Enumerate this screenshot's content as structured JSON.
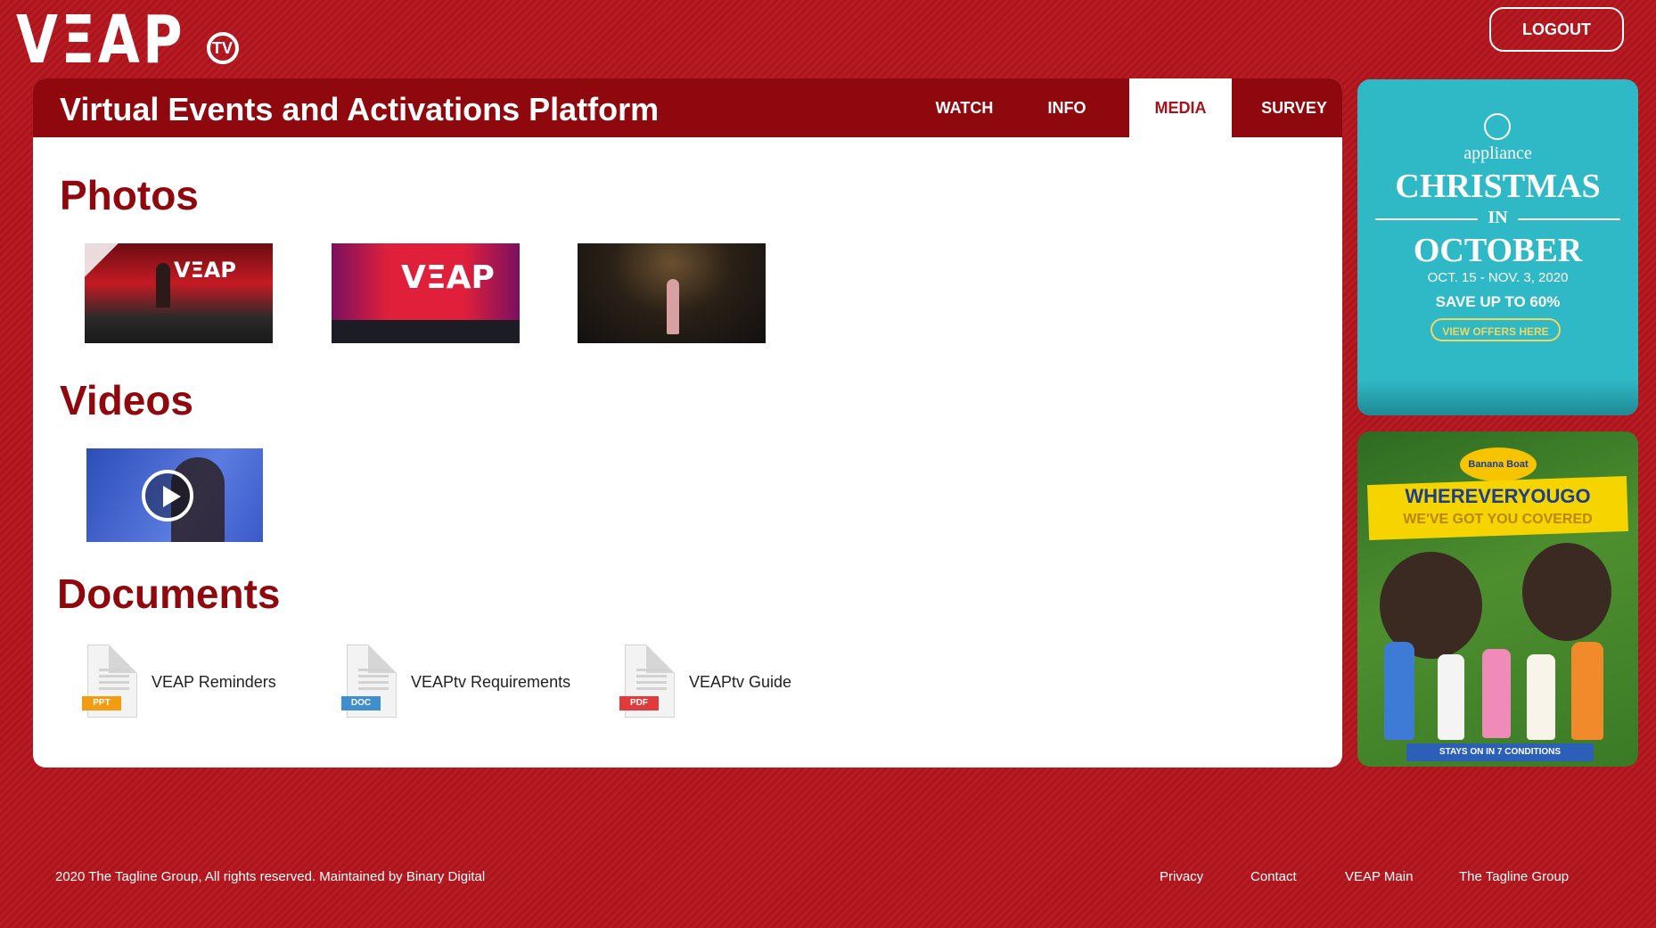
{
  "header": {
    "logo_text": "VΞAP",
    "logo_badge": "TV",
    "logout_label": "LOGOUT"
  },
  "panel": {
    "title": "Virtual Events and Activations Platform",
    "tabs": [
      {
        "label": "WATCH",
        "active": false
      },
      {
        "label": "INFO",
        "active": false
      },
      {
        "label": "MEDIA",
        "active": true
      },
      {
        "label": "SURVEY",
        "active": false
      }
    ]
  },
  "photos": {
    "title": "Photos",
    "items": [
      {
        "thumb_text": "VΞAP"
      },
      {
        "thumb_text": "VΞAP"
      },
      {
        "thumb_text": ""
      }
    ]
  },
  "videos": {
    "title": "Videos",
    "items": [
      {
        "icon": "play-icon"
      }
    ]
  },
  "documents": {
    "title": "Documents",
    "items": [
      {
        "label": "VEAP Reminders",
        "type": "PPT",
        "color": "#f39c12"
      },
      {
        "label": "VEAPtv Requirements",
        "type": "DOC",
        "color": "#3d8fcf"
      },
      {
        "label": "VEAPtv Guide",
        "type": "PDF",
        "color": "#e03a3a"
      }
    ]
  },
  "ads": {
    "ad1": {
      "brand": "appliance",
      "headline_1": "CHRISTMAS",
      "headline_in": "IN",
      "headline_2": "OCTOBER",
      "dates": "OCT. 15 - NOV. 3, 2020",
      "offer": "SAVE UP TO 60%",
      "cta": "VIEW OFFERS HERE"
    },
    "ad2": {
      "brand": "Banana Boat",
      "headline_1": "WHEREVERYOUGO",
      "headline_2": "WE'VE GOT YOU COVERED",
      "footer": "STAYS ON IN 7 CONDITIONS"
    }
  },
  "footer": {
    "copyright": "2020 The Tagline Group, All rights reserved. Maintained by Binary Digital",
    "links": [
      "Privacy",
      "Contact",
      "VEAP Main",
      "The Tagline Group"
    ]
  },
  "colors": {
    "background": "#b3141c",
    "header_bar": "#8f080e",
    "heading": "#8f080e",
    "active_tab_text": "#a3151b"
  }
}
